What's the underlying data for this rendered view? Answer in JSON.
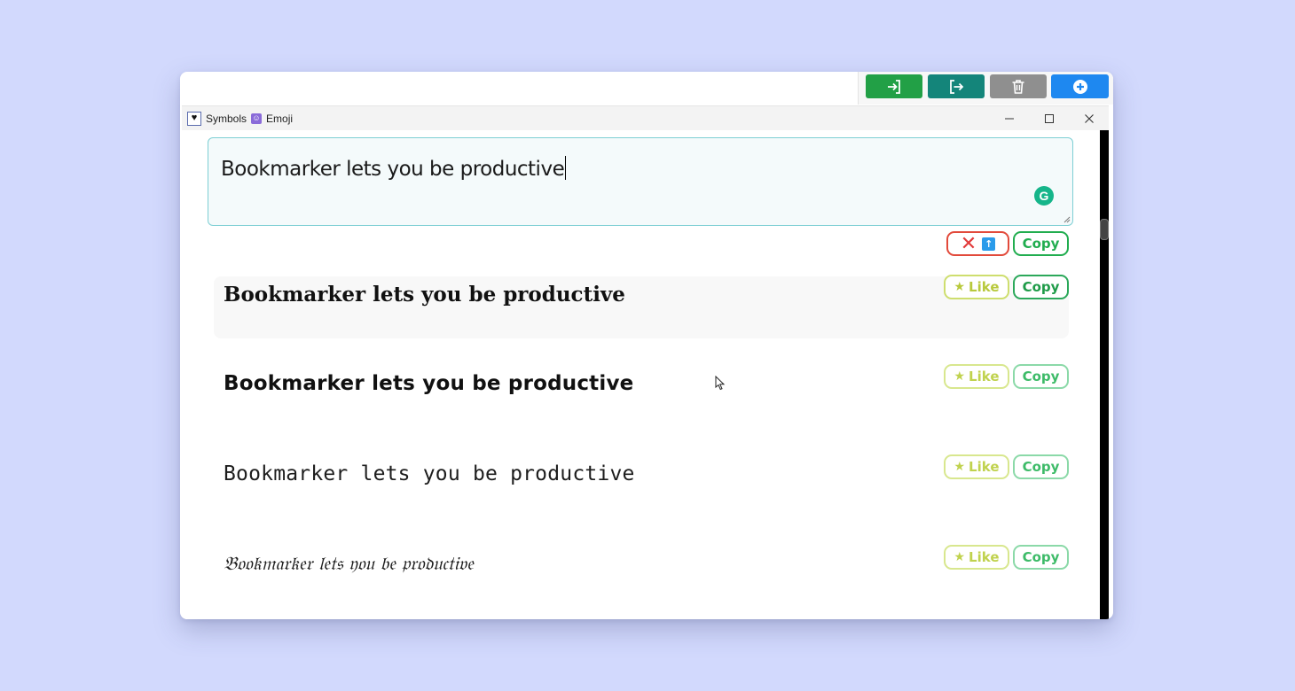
{
  "toolbar": {
    "buttons": [
      {
        "name": "import",
        "icon": "sign-in-icon",
        "color": "#22a046"
      },
      {
        "name": "export",
        "icon": "sign-out-icon",
        "color": "#14857a"
      },
      {
        "name": "delete",
        "icon": "trash-icon",
        "color": "#8f8f8f"
      },
      {
        "name": "add",
        "icon": "plus-circle-icon",
        "color": "#1e88f0"
      }
    ]
  },
  "titlebar": {
    "symbols_icon": "♥",
    "symbols_label": "Symbols",
    "emoji_label": "Emoji"
  },
  "input": {
    "value": "Bookmarker lets you be productive"
  },
  "actions": {
    "copy_label": "Copy"
  },
  "results": [
    {
      "style": "serif-bold",
      "text": "Bookmarker lets you be productive",
      "like_label": "Like",
      "copy_label": "Copy"
    },
    {
      "style": "sans-bold",
      "text": "Bookmarker lets you be productive",
      "like_label": "Like",
      "copy_label": "Copy"
    },
    {
      "style": "monospace",
      "text": "Bookmarker lets you be productive",
      "like_label": "Like",
      "copy_label": "Copy"
    },
    {
      "style": "fraktur",
      "text": "𝔅𝔬𝔬𝔨𝔪𝔞𝔯𝔨𝔢𝔯 𝔩𝔢𝔱𝔰 𝔶𝔬𝔲 𝔟𝔢 𝔭𝔯𝔬𝔡𝔲𝔠𝔱𝔦𝔳𝔢",
      "like_label": "Like",
      "copy_label": "Copy"
    }
  ],
  "colors": {
    "page_bg": "#d2d9fd",
    "accent_green": "#21ad4f",
    "like_yellow": "#b8c93c",
    "clear_red": "#e24a3b"
  }
}
